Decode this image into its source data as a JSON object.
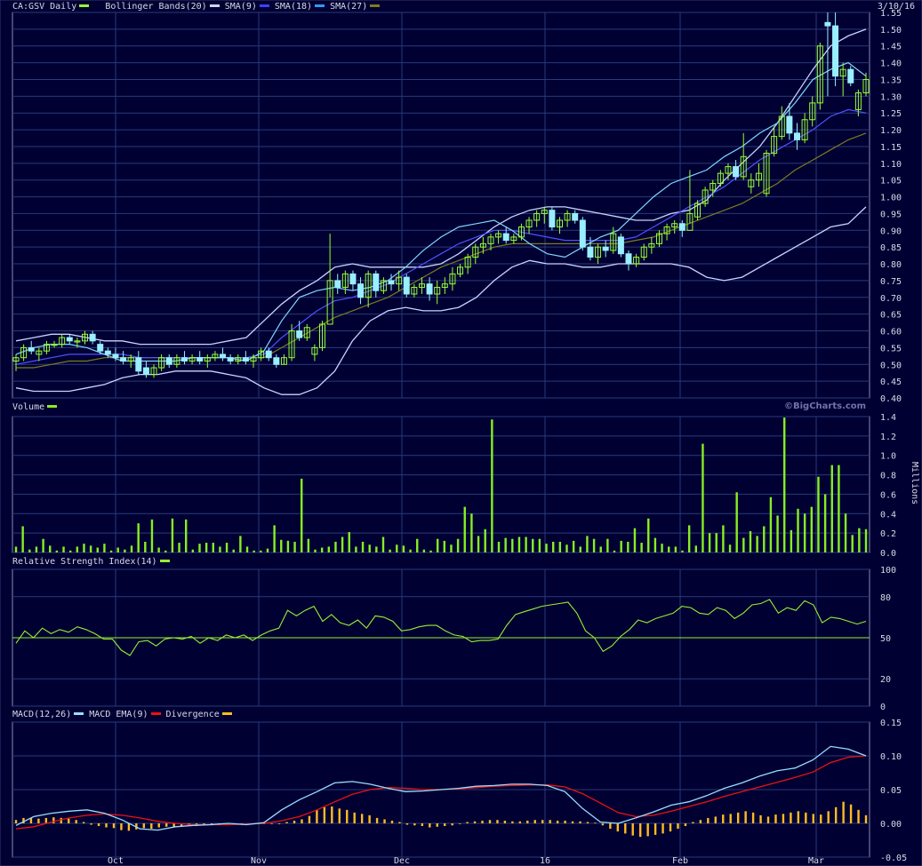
{
  "date_label": "3/10/16",
  "credit": "©BigCharts.com",
  "colors": {
    "bg": "#000033",
    "grid": "#2a3a7a",
    "border": "#8a8ab0",
    "text": "#d9d9e6",
    "candle_up": "#99ff33",
    "candle_down": "#99eeff",
    "bb": "#c9d4ff",
    "sma9": "#7fd6ff",
    "sma18": "#5050ff",
    "sma27": "#7c7c20",
    "volume": "#88ee22",
    "rsi": "#99ee33",
    "macd": "#99ddff",
    "macd_ema": "#ee1111",
    "divergence": "#ffbb22"
  },
  "headers": {
    "price": {
      "symbol": "CA:GSV Daily",
      "items": [
        {
          "label": "Bollinger Bands(20)",
          "color": "#c9d4ff"
        },
        {
          "label": "SMA(9)",
          "color": "#4040ff"
        },
        {
          "label": "SMA(18)",
          "color": "#3399ff"
        },
        {
          "label": "SMA(27)",
          "color": "#7c7c20"
        }
      ]
    },
    "volume": "Volume",
    "rsi": "Relative Strength Index(14)",
    "macd": {
      "items": [
        {
          "label": "MACD(12,26)",
          "color": "#99ddff"
        },
        {
          "label": "MACD EMA(9)",
          "color": "#ee1111"
        },
        {
          "label": "Divergence",
          "color": "#ffbb22"
        }
      ]
    }
  },
  "x_months": [
    "Oct",
    "Nov",
    "Dec",
    "16",
    "Feb",
    "Mar"
  ],
  "price_ticks": [
    "1.55",
    "1.50",
    "1.45",
    "1.40",
    "1.35",
    "1.30",
    "1.25",
    "1.20",
    "1.15",
    "1.10",
    "1.05",
    "1.00",
    "0.95",
    "0.90",
    "0.85",
    "0.80",
    "0.75",
    "0.70",
    "0.65",
    "0.60",
    "0.55",
    "0.50",
    "0.45",
    "0.40"
  ],
  "volume_ticks": [
    "1.4",
    "1.2",
    "1.0",
    "0.8",
    "0.6",
    "0.4",
    "0.2",
    "0.0"
  ],
  "volume_unit": "Millions",
  "rsi_ticks": [
    "100",
    "80",
    "50",
    "20",
    "0"
  ],
  "macd_ticks": [
    "0.15",
    "0.10",
    "0.05",
    "0.00",
    "-0.05"
  ],
  "chart_data": {
    "type": "candlestick",
    "symbol": "CA:GSV",
    "ylim": [
      0.4,
      1.55
    ],
    "candles": [
      [
        0.51,
        0.53,
        0.48,
        0.52
      ],
      [
        0.52,
        0.56,
        0.51,
        0.55
      ],
      [
        0.55,
        0.57,
        0.53,
        0.54
      ],
      [
        0.53,
        0.55,
        0.51,
        0.54
      ],
      [
        0.54,
        0.57,
        0.53,
        0.56
      ],
      [
        0.56,
        0.57,
        0.55,
        0.56
      ],
      [
        0.56,
        0.59,
        0.55,
        0.58
      ],
      [
        0.58,
        0.59,
        0.56,
        0.57
      ],
      [
        0.57,
        0.58,
        0.55,
        0.57
      ],
      [
        0.57,
        0.6,
        0.56,
        0.59
      ],
      [
        0.59,
        0.6,
        0.56,
        0.57
      ],
      [
        0.56,
        0.57,
        0.53,
        0.54
      ],
      [
        0.54,
        0.55,
        0.52,
        0.53
      ],
      [
        0.53,
        0.55,
        0.51,
        0.52
      ],
      [
        0.52,
        0.54,
        0.5,
        0.51
      ],
      [
        0.51,
        0.53,
        0.49,
        0.52
      ],
      [
        0.52,
        0.54,
        0.47,
        0.48
      ],
      [
        0.49,
        0.51,
        0.46,
        0.47
      ],
      [
        0.47,
        0.5,
        0.46,
        0.49
      ],
      [
        0.49,
        0.53,
        0.48,
        0.52
      ],
      [
        0.52,
        0.53,
        0.49,
        0.5
      ],
      [
        0.5,
        0.53,
        0.49,
        0.52
      ],
      [
        0.52,
        0.54,
        0.5,
        0.51
      ],
      [
        0.51,
        0.53,
        0.5,
        0.52
      ],
      [
        0.52,
        0.54,
        0.5,
        0.51
      ],
      [
        0.51,
        0.53,
        0.49,
        0.52
      ],
      [
        0.52,
        0.54,
        0.51,
        0.53
      ],
      [
        0.53,
        0.55,
        0.51,
        0.52
      ],
      [
        0.52,
        0.53,
        0.5,
        0.51
      ],
      [
        0.51,
        0.53,
        0.5,
        0.52
      ],
      [
        0.52,
        0.54,
        0.5,
        0.51
      ],
      [
        0.51,
        0.53,
        0.49,
        0.52
      ],
      [
        0.52,
        0.55,
        0.51,
        0.54
      ],
      [
        0.54,
        0.55,
        0.51,
        0.52
      ],
      [
        0.52,
        0.53,
        0.49,
        0.5
      ],
      [
        0.5,
        0.53,
        0.5,
        0.52
      ],
      [
        0.52,
        0.62,
        0.51,
        0.6
      ],
      [
        0.6,
        0.63,
        0.57,
        0.58
      ],
      [
        0.58,
        0.62,
        0.57,
        0.61
      ],
      [
        0.53,
        0.56,
        0.51,
        0.55
      ],
      [
        0.55,
        0.63,
        0.54,
        0.62
      ],
      [
        0.62,
        0.89,
        0.7,
        0.75
      ],
      [
        0.75,
        0.77,
        0.71,
        0.73
      ],
      [
        0.73,
        0.78,
        0.71,
        0.77
      ],
      [
        0.77,
        0.78,
        0.72,
        0.74
      ],
      [
        0.74,
        0.76,
        0.68,
        0.7
      ],
      [
        0.7,
        0.78,
        0.67,
        0.77
      ],
      [
        0.77,
        0.78,
        0.7,
        0.72
      ],
      [
        0.72,
        0.76,
        0.71,
        0.75
      ],
      [
        0.75,
        0.77,
        0.72,
        0.74
      ],
      [
        0.74,
        0.78,
        0.72,
        0.76
      ],
      [
        0.76,
        0.77,
        0.7,
        0.71
      ],
      [
        0.71,
        0.74,
        0.7,
        0.73
      ],
      [
        0.73,
        0.76,
        0.71,
        0.74
      ],
      [
        0.74,
        0.76,
        0.69,
        0.71
      ],
      [
        0.71,
        0.75,
        0.68,
        0.73
      ],
      [
        0.73,
        0.76,
        0.71,
        0.74
      ],
      [
        0.74,
        0.79,
        0.72,
        0.77
      ],
      [
        0.77,
        0.8,
        0.76,
        0.79
      ],
      [
        0.79,
        0.83,
        0.77,
        0.82
      ],
      [
        0.82,
        0.86,
        0.8,
        0.85
      ],
      [
        0.85,
        0.88,
        0.83,
        0.86
      ],
      [
        0.86,
        0.89,
        0.84,
        0.88
      ],
      [
        0.88,
        0.9,
        0.86,
        0.89
      ],
      [
        0.89,
        0.91,
        0.86,
        0.87
      ],
      [
        0.87,
        0.89,
        0.86,
        0.88
      ],
      [
        0.88,
        0.92,
        0.87,
        0.91
      ],
      [
        0.91,
        0.94,
        0.89,
        0.93
      ],
      [
        0.93,
        0.96,
        0.91,
        0.95
      ],
      [
        0.95,
        0.97,
        0.92,
        0.96
      ],
      [
        0.96,
        0.97,
        0.9,
        0.91
      ],
      [
        0.91,
        0.94,
        0.89,
        0.93
      ],
      [
        0.93,
        0.96,
        0.91,
        0.95
      ],
      [
        0.95,
        0.96,
        0.92,
        0.93
      ],
      [
        0.93,
        0.94,
        0.84,
        0.85
      ],
      [
        0.85,
        0.88,
        0.81,
        0.82
      ],
      [
        0.82,
        0.86,
        0.8,
        0.85
      ],
      [
        0.85,
        0.87,
        0.82,
        0.84
      ],
      [
        0.84,
        0.91,
        0.83,
        0.89
      ],
      [
        0.88,
        0.89,
        0.82,
        0.83
      ],
      [
        0.83,
        0.84,
        0.78,
        0.8
      ],
      [
        0.8,
        0.83,
        0.79,
        0.82
      ],
      [
        0.82,
        0.86,
        0.81,
        0.85
      ],
      [
        0.85,
        0.88,
        0.83,
        0.86
      ],
      [
        0.86,
        0.9,
        0.85,
        0.89
      ],
      [
        0.89,
        0.92,
        0.87,
        0.91
      ],
      [
        0.91,
        0.93,
        0.89,
        0.92
      ],
      [
        0.92,
        0.93,
        0.88,
        0.9
      ],
      [
        0.9,
        1.08,
        0.92,
        0.95
      ],
      [
        0.94,
        0.99,
        0.93,
        0.98
      ],
      [
        0.98,
        1.03,
        0.97,
        1.02
      ],
      [
        1.02,
        1.05,
        1.0,
        1.04
      ],
      [
        1.04,
        1.08,
        1.03,
        1.07
      ],
      [
        1.07,
        1.1,
        1.05,
        1.09
      ],
      [
        1.09,
        1.11,
        1.05,
        1.06
      ],
      [
        1.06,
        1.19,
        1.05,
        1.12
      ],
      [
        1.03,
        1.07,
        1.01,
        1.05
      ],
      [
        1.05,
        1.1,
        1.03,
        1.07
      ],
      [
        1.01,
        1.14,
        1.0,
        1.13
      ],
      [
        1.13,
        1.21,
        1.12,
        1.18
      ],
      [
        1.18,
        1.27,
        1.17,
        1.24
      ],
      [
        1.24,
        1.28,
        1.17,
        1.19
      ],
      [
        1.19,
        1.22,
        1.14,
        1.17
      ],
      [
        1.17,
        1.25,
        1.16,
        1.23
      ],
      [
        1.23,
        1.3,
        1.21,
        1.28
      ],
      [
        1.28,
        1.46,
        1.26,
        1.45
      ],
      [
        1.52,
        1.55,
        1.3,
        1.51
      ],
      [
        1.51,
        1.55,
        1.33,
        1.36
      ],
      [
        1.36,
        1.4,
        1.3,
        1.38
      ],
      [
        1.38,
        1.39,
        1.33,
        1.34
      ],
      [
        1.26,
        1.32,
        1.24,
        1.31
      ],
      [
        1.31,
        1.37,
        1.3,
        1.35
      ]
    ],
    "bollinger_upper": [
      0.57,
      0.58,
      0.59,
      0.59,
      0.58,
      0.57,
      0.57,
      0.56,
      0.56,
      0.56,
      0.56,
      0.56,
      0.57,
      0.58,
      0.63,
      0.68,
      0.72,
      0.75,
      0.79,
      0.8,
      0.79,
      0.79,
      0.79,
      0.79,
      0.8,
      0.83,
      0.87,
      0.91,
      0.94,
      0.96,
      0.97,
      0.97,
      0.96,
      0.95,
      0.94,
      0.93,
      0.93,
      0.95,
      0.96,
      0.99,
      1.05,
      1.1,
      1.15,
      1.22,
      1.3,
      1.38,
      1.45,
      1.48,
      1.5
    ],
    "bollinger_lower": [
      0.43,
      0.42,
      0.42,
      0.42,
      0.43,
      0.44,
      0.46,
      0.47,
      0.47,
      0.48,
      0.48,
      0.48,
      0.47,
      0.46,
      0.43,
      0.41,
      0.41,
      0.43,
      0.48,
      0.57,
      0.63,
      0.66,
      0.67,
      0.66,
      0.66,
      0.67,
      0.7,
      0.75,
      0.79,
      0.81,
      0.8,
      0.8,
      0.79,
      0.79,
      0.8,
      0.8,
      0.8,
      0.8,
      0.79,
      0.76,
      0.75,
      0.76,
      0.79,
      0.82,
      0.85,
      0.88,
      0.91,
      0.92,
      0.97
    ],
    "sma9": [
      0.53,
      0.55,
      0.56,
      0.56,
      0.55,
      0.53,
      0.51,
      0.51,
      0.51,
      0.51,
      0.52,
      0.52,
      0.52,
      0.51,
      0.54,
      0.63,
      0.7,
      0.72,
      0.73,
      0.72,
      0.73,
      0.75,
      0.79,
      0.84,
      0.88,
      0.91,
      0.92,
      0.93,
      0.9,
      0.86,
      0.83,
      0.82,
      0.85,
      0.88,
      0.9,
      0.95,
      1.0,
      1.04,
      1.06,
      1.08,
      1.12,
      1.15,
      1.19,
      1.22,
      1.28,
      1.35,
      1.38,
      1.4,
      1.36
    ],
    "sma18": [
      0.5,
      0.51,
      0.52,
      0.53,
      0.53,
      0.53,
      0.53,
      0.52,
      0.52,
      0.52,
      0.52,
      0.52,
      0.52,
      0.52,
      0.53,
      0.58,
      0.62,
      0.66,
      0.69,
      0.7,
      0.72,
      0.74,
      0.77,
      0.8,
      0.83,
      0.86,
      0.88,
      0.9,
      0.9,
      0.89,
      0.88,
      0.87,
      0.87,
      0.87,
      0.87,
      0.88,
      0.91,
      0.94,
      0.97,
      1.0,
      1.03,
      1.07,
      1.11,
      1.14,
      1.17,
      1.2,
      1.24,
      1.26,
      1.25
    ],
    "sma27": [
      0.49,
      0.49,
      0.5,
      0.51,
      0.51,
      0.52,
      0.52,
      0.52,
      0.52,
      0.52,
      0.52,
      0.52,
      0.52,
      0.52,
      0.52,
      0.55,
      0.58,
      0.61,
      0.64,
      0.66,
      0.68,
      0.7,
      0.73,
      0.76,
      0.79,
      0.81,
      0.83,
      0.85,
      0.86,
      0.86,
      0.86,
      0.86,
      0.86,
      0.86,
      0.86,
      0.87,
      0.88,
      0.9,
      0.92,
      0.94,
      0.96,
      0.98,
      1.01,
      1.04,
      1.08,
      1.11,
      1.14,
      1.17,
      1.19
    ],
    "volume_millions": [
      0.06,
      0.27,
      0.03,
      0.06,
      0.14,
      0.07,
      0.02,
      0.06,
      0.02,
      0.06,
      0.09,
      0.07,
      0.05,
      0.09,
      0.02,
      0.05,
      0.03,
      0.07,
      0.3,
      0.11,
      0.34,
      0.05,
      0.02,
      0.35,
      0.1,
      0.34,
      0.03,
      0.09,
      0.1,
      0.1,
      0.06,
      0.1,
      0.03,
      0.17,
      0.06,
      0.02,
      0.02,
      0.04,
      0.28,
      0.13,
      0.12,
      0.11,
      0.76,
      0.14,
      0.03,
      0.05,
      0.06,
      0.11,
      0.16,
      0.21,
      0.06,
      0.11,
      0.08,
      0.06,
      0.16,
      0.03,
      0.08,
      0.07,
      0.03,
      0.14,
      0.03,
      0.02,
      0.14,
      0.12,
      0.08,
      0.14,
      0.47,
      0.4,
      0.17,
      0.24,
      1.37,
      0.11,
      0.15,
      0.14,
      0.16,
      0.16,
      0.14,
      0.14,
      0.09,
      0.11,
      0.11,
      0.08,
      0.12,
      0.06,
      0.17,
      0.14,
      0.06,
      0.14,
      0.02,
      0.12,
      0.11,
      0.25,
      0.1,
      0.35,
      0.15,
      0.09,
      0.06,
      0.06,
      0.02,
      0.28,
      0.07,
      1.12,
      0.2,
      0.2,
      0.28,
      0.08,
      0.62,
      0.15,
      0.22,
      0.17,
      0.27,
      0.57,
      0.38,
      1.39,
      0.23,
      0.45,
      0.4,
      0.47,
      0.78,
      0.6,
      0.9,
      0.9,
      0.4,
      0.18,
      0.25,
      0.24
    ],
    "rsi": [
      46,
      55,
      50,
      57,
      53,
      56,
      54,
      58,
      56,
      53,
      49,
      49,
      41,
      37,
      47,
      48,
      44,
      49,
      50,
      49,
      51,
      46,
      50,
      48,
      52,
      50,
      52,
      48,
      52,
      55,
      57,
      70,
      66,
      70,
      73,
      62,
      67,
      61,
      59,
      63,
      57,
      66,
      65,
      62,
      55,
      56,
      58,
      59,
      59,
      55,
      52,
      51,
      47,
      48,
      48,
      49,
      59,
      67,
      69,
      71,
      73,
      74,
      75,
      76,
      68,
      55,
      50,
      40,
      44,
      51,
      56,
      63,
      61,
      64,
      66,
      68,
      73,
      72,
      68,
      67,
      72,
      70,
      64,
      68,
      74,
      75,
      78,
      68,
      72,
      70,
      77,
      74,
      61,
      65,
      64,
      62,
      60,
      62
    ],
    "macd": [
      -0.003,
      0.01,
      0.015,
      0.018,
      0.02,
      0.015,
      0.005,
      -0.008,
      -0.01,
      -0.005,
      -0.003,
      -0.002,
      0.0,
      -0.002,
      0.001,
      0.02,
      0.035,
      0.047,
      0.06,
      0.062,
      0.058,
      0.052,
      0.047,
      0.048,
      0.05,
      0.052,
      0.055,
      0.056,
      0.058,
      0.058,
      0.056,
      0.047,
      0.022,
      0.002,
      0.0,
      0.008,
      0.017,
      0.027,
      0.032,
      0.041,
      0.052,
      0.06,
      0.07,
      0.078,
      0.082,
      0.094,
      0.114,
      0.11,
      0.1
    ],
    "macd_ema": [
      -0.008,
      -0.005,
      0.002,
      0.008,
      0.012,
      0.014,
      0.012,
      0.008,
      0.003,
      0.0,
      -0.002,
      -0.002,
      -0.002,
      -0.001,
      0.0,
      0.004,
      0.01,
      0.02,
      0.032,
      0.043,
      0.05,
      0.053,
      0.052,
      0.05,
      0.05,
      0.051,
      0.053,
      0.055,
      0.056,
      0.057,
      0.057,
      0.054,
      0.044,
      0.03,
      0.016,
      0.01,
      0.012,
      0.018,
      0.025,
      0.032,
      0.04,
      0.047,
      0.054,
      0.061,
      0.068,
      0.076,
      0.09,
      0.098,
      0.1
    ],
    "divergence": [
      0.005,
      0.008,
      0.008,
      0.007,
      0.008,
      0.009,
      0.008,
      0.007,
      0.005,
      0.002,
      -0.002,
      -0.004,
      -0.006,
      -0.007,
      -0.01,
      -0.011,
      -0.009,
      -0.007,
      -0.008,
      -0.006,
      -0.005,
      -0.006,
      -0.005,
      -0.004,
      -0.004,
      -0.003,
      -0.002,
      -0.002,
      -0.001,
      0.0,
      -0.001,
      0.0,
      0.0,
      0.0,
      -0.001,
      0.0,
      0.002,
      0.004,
      0.006,
      0.011,
      0.02,
      0.024,
      0.025,
      0.022,
      0.02,
      0.016,
      0.014,
      0.012,
      0.008,
      0.006,
      0.004,
      0.002,
      -0.002,
      -0.003,
      -0.004,
      -0.006,
      -0.005,
      -0.004,
      -0.003,
      0.0,
      0.002,
      0.003,
      0.004,
      0.005,
      0.005,
      0.004,
      0.003,
      0.003,
      0.004,
      0.005,
      0.005,
      0.005,
      0.004,
      0.004,
      0.003,
      0.003,
      0.002,
      0.001,
      -0.003,
      -0.008,
      -0.012,
      -0.015,
      -0.018,
      -0.02,
      -0.019,
      -0.017,
      -0.015,
      -0.012,
      -0.008,
      -0.004,
      0.002,
      0.005,
      0.008,
      0.01,
      0.013,
      0.014,
      0.016,
      0.018,
      0.016,
      0.012,
      0.01,
      0.013,
      0.014,
      0.016,
      0.018,
      0.016,
      0.014,
      0.013,
      0.018,
      0.024,
      0.032,
      0.028,
      0.02,
      0.012
    ]
  }
}
